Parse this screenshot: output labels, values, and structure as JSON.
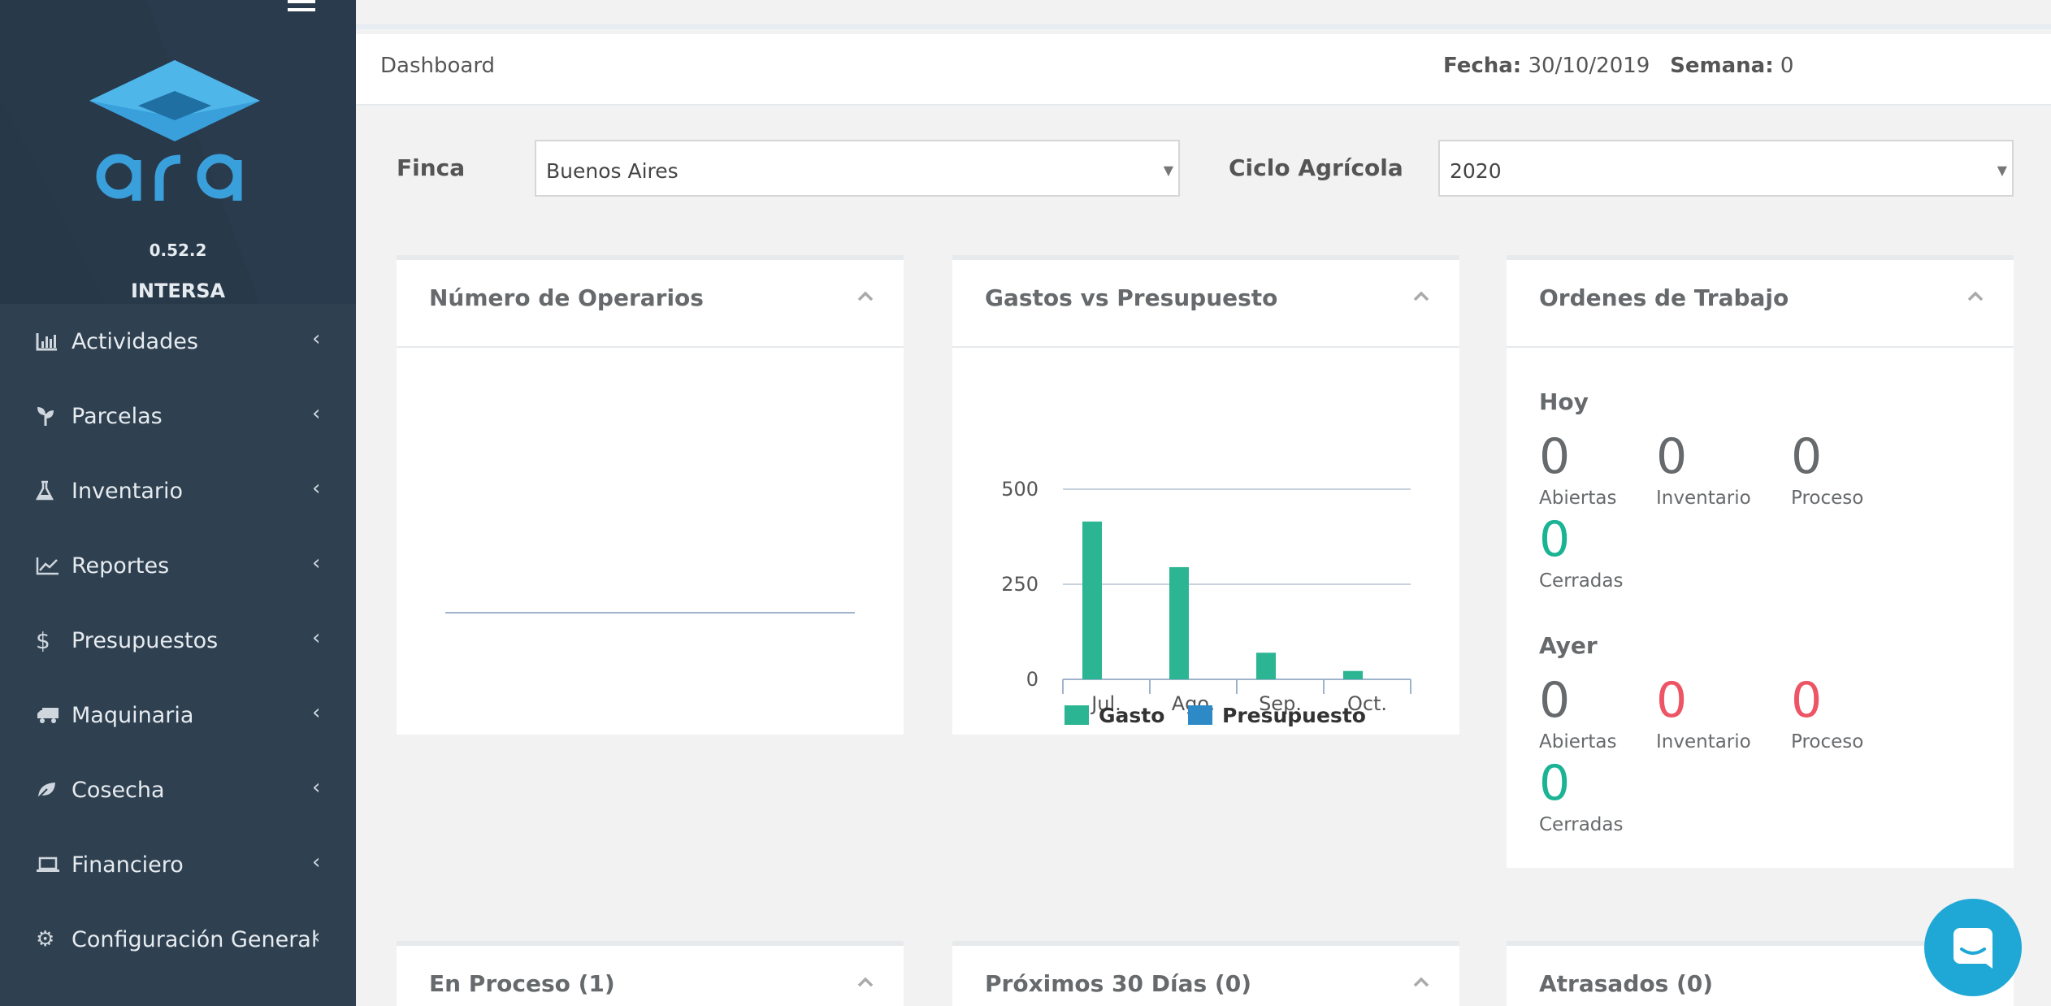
{
  "sidebar": {
    "version": "0.52.2",
    "company": "INTERSA",
    "items": [
      {
        "label": "Actividades",
        "icon": "bar-chart-icon"
      },
      {
        "label": "Parcelas",
        "icon": "seedling-icon"
      },
      {
        "label": "Inventario",
        "icon": "flask-icon"
      },
      {
        "label": "Reportes",
        "icon": "line-chart-icon"
      },
      {
        "label": "Presupuestos",
        "icon": "dollar-icon"
      },
      {
        "label": "Maquinaria",
        "icon": "truck-icon"
      },
      {
        "label": "Cosecha",
        "icon": "leaf-icon"
      },
      {
        "label": "Financiero",
        "icon": "laptop-icon"
      },
      {
        "label": "Configuración General",
        "icon": "gear-icon"
      }
    ]
  },
  "header": {
    "breadcrumb": "Dashboard",
    "fecha_label": "Fecha:",
    "fecha_value": "30/10/2019",
    "semana_label": "Semana:",
    "semana_value": "0"
  },
  "filters": {
    "finca_label": "Finca",
    "finca_value": "Buenos Aires",
    "ciclo_label": "Ciclo Agrícola",
    "ciclo_value": "2020"
  },
  "panels": {
    "operarios_title": "Número de Operarios",
    "gastos_title": "Gastos vs Presupuesto",
    "ordenes_title": "Ordenes de Trabajo",
    "en_proceso_title": "En Proceso (1)",
    "proximos_title": "Próximos 30 Días (0)",
    "atrasados_title": "Atrasados (0)"
  },
  "ordenes": {
    "hoy": {
      "label": "Hoy",
      "abiertas": "0",
      "abiertas_label": "Abiertas",
      "inventario": "0",
      "inventario_label": "Inventario",
      "proceso": "0",
      "proceso_label": "Proceso",
      "cerradas": "0",
      "cerradas_label": "Cerradas"
    },
    "ayer": {
      "label": "Ayer",
      "abiertas": "0",
      "abiertas_label": "Abiertas",
      "inventario": "0",
      "inventario_label": "Inventario",
      "proceso": "0",
      "proceso_label": "Proceso",
      "cerradas": "0",
      "cerradas_label": "Cerradas"
    }
  },
  "colors": {
    "sidebar": "#2f4050",
    "teal": "#1ab394",
    "red": "#ed5565",
    "gasto": "#2bb593",
    "presupuesto": "#2d8ac7"
  },
  "chart_data": {
    "type": "bar",
    "categories": [
      "Jul.",
      "Ago.",
      "Sep.",
      "Oct."
    ],
    "series": [
      {
        "name": "Gasto",
        "values": [
          415,
          295,
          70,
          22
        ]
      },
      {
        "name": "Presupuesto",
        "values": [
          0,
          0,
          0,
          0
        ]
      }
    ],
    "yticks": [
      "500",
      "250",
      "0"
    ],
    "ylim": [
      0,
      500
    ],
    "grid": true,
    "legend": "bottom"
  }
}
